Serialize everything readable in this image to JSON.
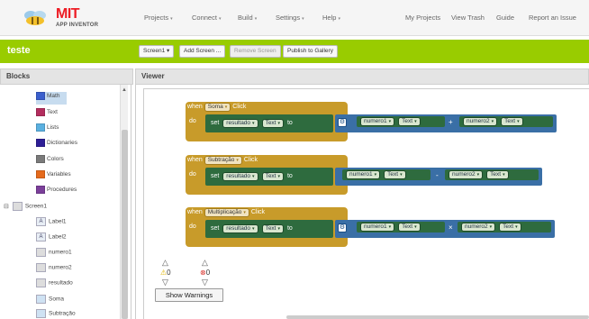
{
  "app": {
    "logo_text": "MIT",
    "logo_subtext": "APP INVENTOR",
    "nav_left": [
      {
        "label": "Projects",
        "caret": "▾"
      },
      {
        "label": "Connect",
        "caret": "▾"
      },
      {
        "label": "Build",
        "caret": "▾"
      },
      {
        "label": "Settings",
        "caret": "▾"
      },
      {
        "label": "Help",
        "caret": "▾"
      }
    ],
    "nav_right": [
      "My Projects",
      "View Trash",
      "Guide",
      "Report an Issue"
    ]
  },
  "project": {
    "name": "teste",
    "screen_select": "Screen1",
    "screen_caret": "▾",
    "buttons": [
      "Add Screen ...",
      "Remove Screen",
      "Publish to Gallery"
    ]
  },
  "panels": {
    "blocks_header": "Blocks",
    "viewer_header": "Viewer"
  },
  "builtin_blocks": [
    {
      "label": "Math",
      "color": "#3a5fcd"
    },
    {
      "label": "Text",
      "color": "#b32d5e"
    },
    {
      "label": "Lists",
      "color": "#5ab0e0"
    },
    {
      "label": "Dictionaries",
      "color": "#2d1e96"
    },
    {
      "label": "Colors",
      "color": "#7a7a7a"
    },
    {
      "label": "Variables",
      "color": "#e56a1c"
    },
    {
      "label": "Procedures",
      "color": "#7b3f9a"
    }
  ],
  "component_tree": {
    "root": "Screen1",
    "collapse": "⊟",
    "children": [
      {
        "label": "Label1",
        "icon": "A"
      },
      {
        "label": "Label2",
        "icon": "A"
      },
      {
        "label": "numero1",
        "icon": ""
      },
      {
        "label": "numero2",
        "icon": ""
      },
      {
        "label": "resultado",
        "icon": ""
      },
      {
        "label": "Soma",
        "icon": ""
      },
      {
        "label": "Subtração",
        "icon": ""
      }
    ]
  },
  "code_blocks": [
    {
      "when": "when",
      "component": "Soma",
      "event": "Click",
      "do": "do",
      "set": "set",
      "target": "resultado",
      "prop": "Text",
      "to": "to",
      "op1": "numero1",
      "op2": "numero2",
      "opprop": "Text",
      "operator": "+",
      "has_gear": true
    },
    {
      "when": "when",
      "component": "Subtração",
      "event": "Click",
      "do": "do",
      "set": "set",
      "target": "resultado",
      "prop": "Text",
      "to": "to",
      "op1": "numero1",
      "op2": "numero2",
      "opprop": "Text",
      "operator": "-",
      "has_gear": false
    },
    {
      "when": "when",
      "component": "Multiplicação",
      "event": "Click",
      "do": "do",
      "set": "set",
      "target": "resultado",
      "prop": "Text",
      "to": "to",
      "op1": "numero1",
      "op2": "numero2",
      "opprop": "Text",
      "operator": "×",
      "has_gear": true
    }
  ],
  "warnings": {
    "warning_count": "0",
    "error_count": "0",
    "show_warnings_label": "Show Warnings"
  }
}
